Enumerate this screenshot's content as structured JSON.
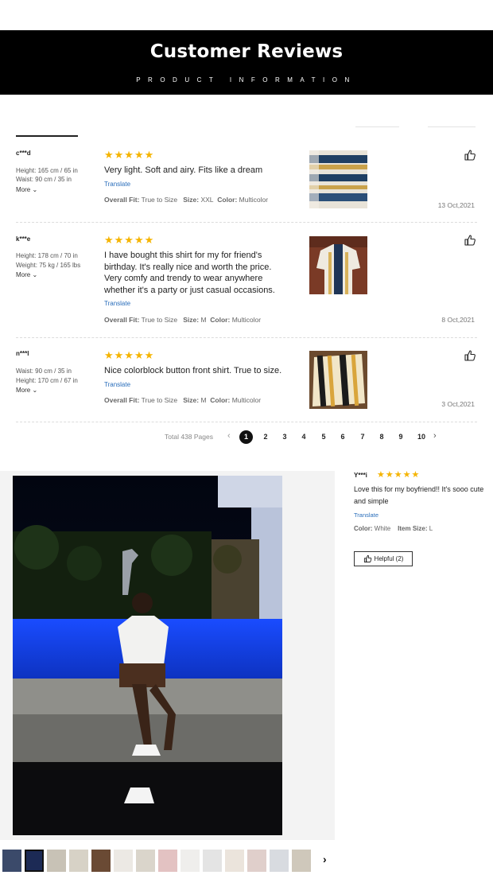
{
  "banner": {
    "title": "Customer Reviews",
    "subtitle": "PRODUCT INFORMATION"
  },
  "reviews": [
    {
      "user": "c***d",
      "meta1": "Height: 165 cm / 65 in",
      "meta2": "Waist: 90 cm / 35 in",
      "more": "More ⌄",
      "stars": "★★★★★",
      "text_lines": [
        "Very light. Soft and airy. Fits like a dream"
      ],
      "translate": "Translate",
      "fit_label": "Overall Fit:",
      "fit_value": "True to Size",
      "size_label": "Size:",
      "size_value": "XXL",
      "color_label": "Color:",
      "color_value": "Multicolor",
      "date": "13 Oct,2021"
    },
    {
      "user": "k***e",
      "meta1": "Height: 178 cm / 70 in",
      "meta2": "Weight: 75 kg / 165 lbs",
      "more": "More ⌄",
      "stars": "★★★★★",
      "text_lines": [
        "I have bought this shirt for my for friend's",
        "birthday. It's really nice and worth the price.",
        "Very comfy and trendy to wear anywhere",
        "whether it's a party or just casual occasions."
      ],
      "translate": "Translate",
      "fit_label": "Overall Fit:",
      "fit_value": "True to Size",
      "size_label": "Size:",
      "size_value": "M",
      "color_label": "Color:",
      "color_value": "Multicolor",
      "date": "8 Oct,2021"
    },
    {
      "user": "n***l",
      "meta1": "Waist: 90 cm / 35 in",
      "meta2": "Height: 170 cm / 67 in",
      "more": "More ⌄",
      "stars": "★★★★★",
      "text_lines": [
        "Nice colorblock button front shirt. True to size."
      ],
      "translate": "Translate",
      "fit_label": "Overall Fit:",
      "fit_value": "True to Size",
      "size_label": "Size:",
      "size_value": "M",
      "color_label": "Color:",
      "color_value": "Multicolor",
      "date": "3 Oct,2021"
    }
  ],
  "pagination": {
    "total": "Total 438 Pages",
    "prev": "‹",
    "pages": [
      "1",
      "2",
      "3",
      "4",
      "5",
      "6",
      "7",
      "8",
      "9",
      "10"
    ],
    "current": "1",
    "next": "›"
  },
  "featured": {
    "user": "Y***i",
    "stars": "★★★★★",
    "text_lines": [
      "Love this for my boyfriend!! It's sooo cute",
      "and simple"
    ],
    "translate": "Translate",
    "color_label": "Color:",
    "color_value": "White",
    "size_label": "Item Size:",
    "size_value": "L",
    "helpful": "Helpful (2)"
  },
  "colors": {
    "star": "#f5b400",
    "link": "#2a6ebb",
    "banner_bg": "#000000"
  },
  "icons": {
    "like": "thumbs-up-icon",
    "next": "chevron-right-icon"
  }
}
